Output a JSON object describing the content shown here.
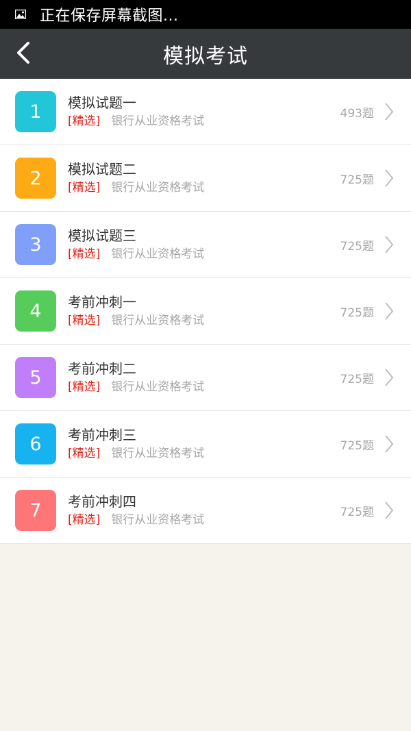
{
  "status_bar": {
    "text": "正在保存屏幕截图...",
    "icon": "image-icon"
  },
  "header": {
    "title": "模拟考试",
    "back_icon": "chevron-left-icon"
  },
  "list": {
    "items": [
      {
        "number": "1",
        "title": "模拟试题一",
        "tag": "[精选]",
        "subtitle": "银行从业资格考试",
        "count": "493题",
        "color": "#23c6d9"
      },
      {
        "number": "2",
        "title": "模拟试题二",
        "tag": "[精选]",
        "subtitle": "银行从业资格考试",
        "count": "725题",
        "color": "#fdaa14"
      },
      {
        "number": "3",
        "title": "模拟试题三",
        "tag": "[精选]",
        "subtitle": "银行从业资格考试",
        "count": "725题",
        "color": "#7f9ff9"
      },
      {
        "number": "4",
        "title": "考前冲刺一",
        "tag": "[精选]",
        "subtitle": "银行从业资格考试",
        "count": "725题",
        "color": "#56cd5a"
      },
      {
        "number": "5",
        "title": "考前冲刺二",
        "tag": "[精选]",
        "subtitle": "银行从业资格考试",
        "count": "725题",
        "color": "#c07efa"
      },
      {
        "number": "6",
        "title": "考前冲刺三",
        "tag": "[精选]",
        "subtitle": "银行从业资格考试",
        "count": "725题",
        "color": "#17b3f0"
      },
      {
        "number": "7",
        "title": "考前冲刺四",
        "tag": "[精选]",
        "subtitle": "银行从业资格考试",
        "count": "725题",
        "color": "#fe7678"
      }
    ]
  },
  "colors": {
    "status_bar_bg": "#000000",
    "header_bg": "#363a3c",
    "tag_red": "#e2231a",
    "muted_text": "#a6a6a6",
    "page_bg": "#f6f3ec"
  }
}
